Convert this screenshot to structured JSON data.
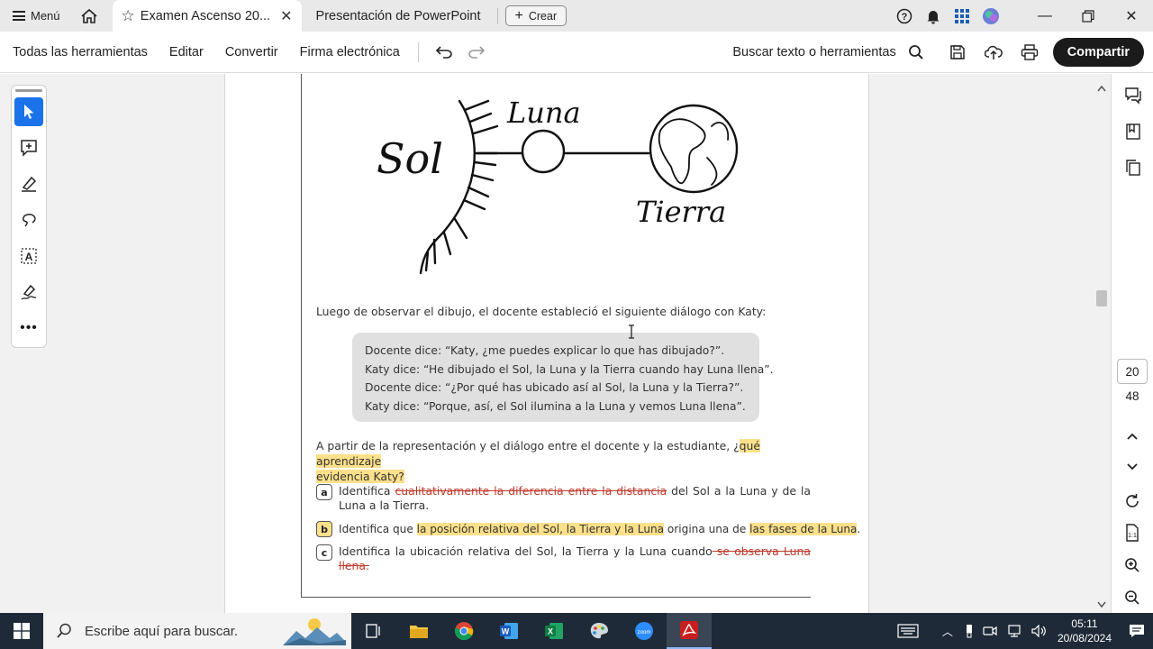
{
  "tabbar": {
    "menu_label": "Menú",
    "active_tab_title": "Examen Ascenso 20...",
    "inactive_tab_title": "Presentación de PowerPoint",
    "create_label": "Crear"
  },
  "toolbar": {
    "items": [
      "Todas las herramientas",
      "Editar",
      "Convertir",
      "Firma electrónica"
    ],
    "search_label": "Buscar texto o herramientas",
    "share_label": "Compartir"
  },
  "document": {
    "drawing_labels": {
      "sun": "Sol",
      "moon": "Luna",
      "earth": "Tierra"
    },
    "intro": "Luego de observar el dibujo, el docente estableció el siguiente diálogo con Katy:",
    "dialog": [
      "Docente dice: “Katy, ¿me puedes explicar lo que has dibujado?”.",
      "Katy dice: “He dibujado el Sol, la Luna y la Tierra cuando hay Luna llena”.",
      "Docente dice: “¿Por qué has ubicado así al Sol, la Luna y la Tierra?”.",
      "Katy dice: “Porque, así, el Sol ilumina a la Luna y vemos Luna llena”."
    ],
    "question_plain": "A partir de la representación y el diálogo entre el docente y la estudiante, ¿",
    "question_highlight_1": "qué aprendizaje",
    "question_highlight_2": "evidencia Katy?",
    "options": {
      "a": {
        "letter": "a",
        "p1": "Identifica ",
        "strike": "cualitativamente la diferencia entre la distancia",
        "p2": " del Sol a la Luna y de la Luna a la Tierra."
      },
      "b": {
        "letter": "b",
        "p1": "Identifica que ",
        "hl1": "la posición relativa del Sol, la Tierra y la Luna",
        "p2": " origina una de ",
        "hl2": "las fases de la Luna",
        "p3": "."
      },
      "c": {
        "letter": "c",
        "p1": "Identifica la ubicación relativa del Sol, la Tierra y la Luna cuando",
        "strike": " se observa Luna llena."
      }
    }
  },
  "pagination": {
    "current": "20",
    "total": "48"
  },
  "taskbar": {
    "search_placeholder": "Escribe aquí para buscar.",
    "time": "05:11",
    "date": "20/08/2024"
  },
  "colors": {
    "accent": "#1a73e8",
    "highlight": "#fde08a",
    "strike": "#c0392b",
    "taskbar": "#1f2a38"
  }
}
